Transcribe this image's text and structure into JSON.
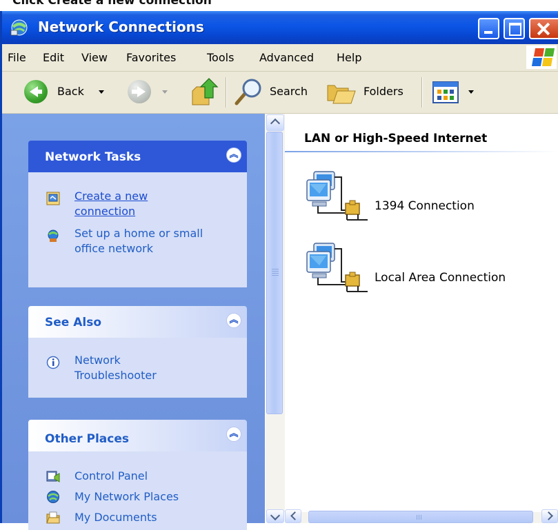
{
  "caption": "Click Create a new connection",
  "window": {
    "title": "Network Connections"
  },
  "menu": [
    "File",
    "Edit",
    "View",
    "Favorites",
    "Tools",
    "Advanced",
    "Help"
  ],
  "toolbar": {
    "back": "Back",
    "search": "Search",
    "folders": "Folders"
  },
  "taskpane": {
    "network_tasks": {
      "title": "Network Tasks",
      "create_line1": "Create a new",
      "create_line2": "connection",
      "setup_line1": "Set up a home or small",
      "setup_line2": "office network"
    },
    "see_also": {
      "title": "See Also",
      "troubleshooter_line1": "Network",
      "troubleshooter_line2": "Troubleshooter"
    },
    "other_places": {
      "title": "Other Places",
      "items": [
        "Control Panel",
        "My Network Places",
        "My Documents"
      ]
    }
  },
  "content": {
    "section": "LAN or High-Speed Internet",
    "connections": [
      "1394 Connection",
      "Local Area Connection"
    ]
  },
  "colors": {
    "titlebar": "#0b55e6",
    "taskpane": "#7ba2e7",
    "link": "#1c4bd0"
  }
}
